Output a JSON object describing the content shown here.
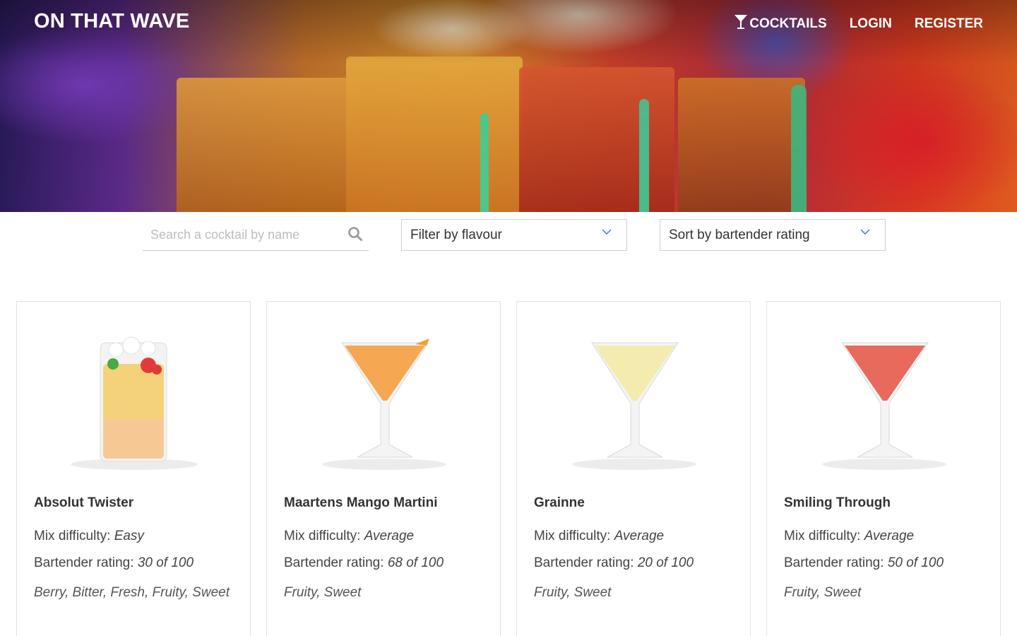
{
  "brand": "ON THAT WAVE",
  "nav": {
    "cocktails": "COCKTAILS",
    "login": "LOGIN",
    "register": "REGISTER"
  },
  "filters": {
    "search_placeholder": "Search a cocktail by name",
    "search_value": "",
    "flavour_selected": "Filter by flavour",
    "sort_selected": "Sort by bartender rating"
  },
  "labels": {
    "mix_difficulty": "Mix difficulty:",
    "bartender_rating": "Bartender rating:"
  },
  "cocktails": [
    {
      "name": "Absolut Twister",
      "difficulty": "Easy",
      "rating": "30 of 100",
      "flavours": "Berry, Bitter, Fresh, Fruity, Sweet",
      "glass": "highball",
      "color": "#f3d27a"
    },
    {
      "name": "Maartens Mango Martini",
      "difficulty": "Average",
      "rating": "68 of 100",
      "flavours": "Fruity, Sweet",
      "glass": "martini",
      "color": "#f5a851"
    },
    {
      "name": "Grainne",
      "difficulty": "Average",
      "rating": "20 of 100",
      "flavours": "Fruity, Sweet",
      "glass": "martini",
      "color": "#f3ecae"
    },
    {
      "name": "Smiling Through",
      "difficulty": "Average",
      "rating": "50 of 100",
      "flavours": "Fruity, Sweet",
      "glass": "martini",
      "color": "#e86a5c"
    }
  ]
}
